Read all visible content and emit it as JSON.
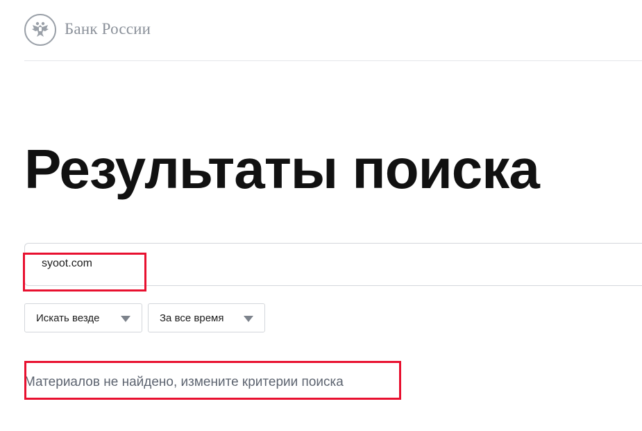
{
  "header": {
    "logo_text": "Банк России",
    "logo_icon": "double-headed-eagle-icon"
  },
  "page": {
    "title": "Результаты поиска"
  },
  "search": {
    "query": "syoot.com"
  },
  "filters": {
    "scope": {
      "label": "Искать везде",
      "icon": "triangle-down-icon"
    },
    "period": {
      "label": "За все время",
      "icon": "triangle-down-icon"
    }
  },
  "results": {
    "empty_message": "Материалов не найдено, измените критерии поиска"
  },
  "colors": {
    "highlight": "#e8102f",
    "logo_gray": "#8a9099",
    "arrow_gray": "#7d838c"
  }
}
